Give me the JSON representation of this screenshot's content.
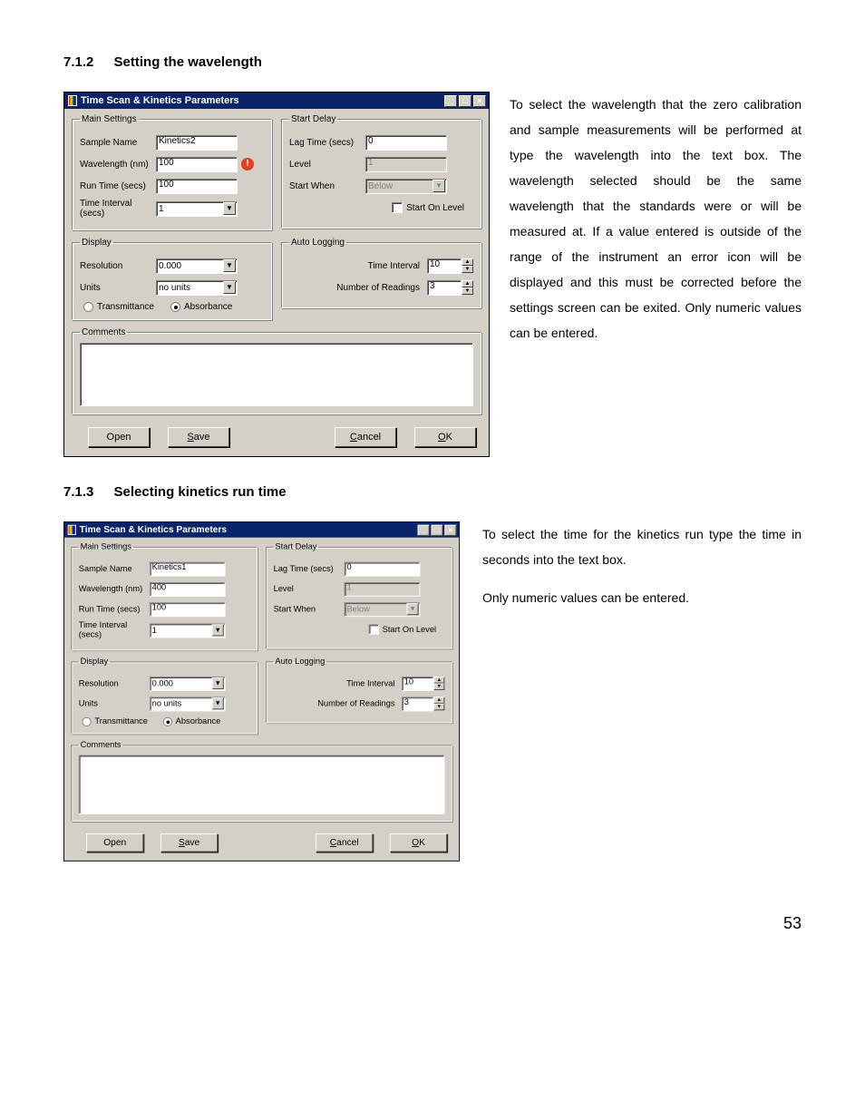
{
  "page_number": "53",
  "section1": {
    "number": "7.1.2",
    "title": "Setting the wavelength",
    "text": "To select the wavelength that the zero calibration and sample measurements will be performed at type the wavelength into the text box. The wavelength selected should be the same wavelength that the standards were or will be measured at. If a value entered is outside of the range of the instrument an error icon will be displayed and this must be corrected before the settings screen can be exited. Only numeric values can be entered."
  },
  "section2": {
    "number": "7.1.3",
    "title": "Selecting kinetics run time",
    "text1": "To select the time for the kinetics run type the time in seconds into the text box.",
    "text2": "Only numeric values can be entered."
  },
  "dialog1": {
    "title": "Time Scan & Kinetics Parameters",
    "groups": {
      "main": "Main Settings",
      "start": "Start Delay",
      "display": "Display",
      "autolog": "Auto Logging",
      "comments": "Comments"
    },
    "labels": {
      "sample_name": "Sample Name",
      "wavelength": "Wavelength (nm)",
      "run_time": "Run Time (secs)",
      "time_interval": "Time Interval (secs)",
      "lag_time": "Lag Time (secs)",
      "level": "Level",
      "start_when": "Start When",
      "start_on_level": "Start On Level",
      "resolution": "Resolution",
      "units": "Units",
      "transmittance": "Transmittance",
      "absorbance": "Absorbance",
      "al_time_interval": "Time Interval",
      "al_num_readings": "Number of Readings"
    },
    "values": {
      "sample_name": "Kinetics2",
      "wavelength": "100",
      "run_time": "100",
      "time_interval": "1",
      "lag_time": "0",
      "level": "1",
      "start_when": "Below",
      "resolution": "0.000",
      "units": "no units",
      "al_time_interval": "10",
      "al_num_readings": "3"
    },
    "buttons": {
      "open": "Open",
      "save": "Save",
      "cancel": "Cancel",
      "ok": "OK"
    },
    "show_error_icon": true,
    "start_disabled": true
  },
  "dialog2": {
    "title": "Time Scan & Kinetics Parameters",
    "values": {
      "sample_name": "Kinetics1",
      "wavelength": "400",
      "run_time": "100",
      "time_interval": "1",
      "lag_time": "0",
      "level": "1",
      "start_when": "Below",
      "resolution": "0.000",
      "units": "no units",
      "al_time_interval": "10",
      "al_num_readings": "3"
    }
  }
}
